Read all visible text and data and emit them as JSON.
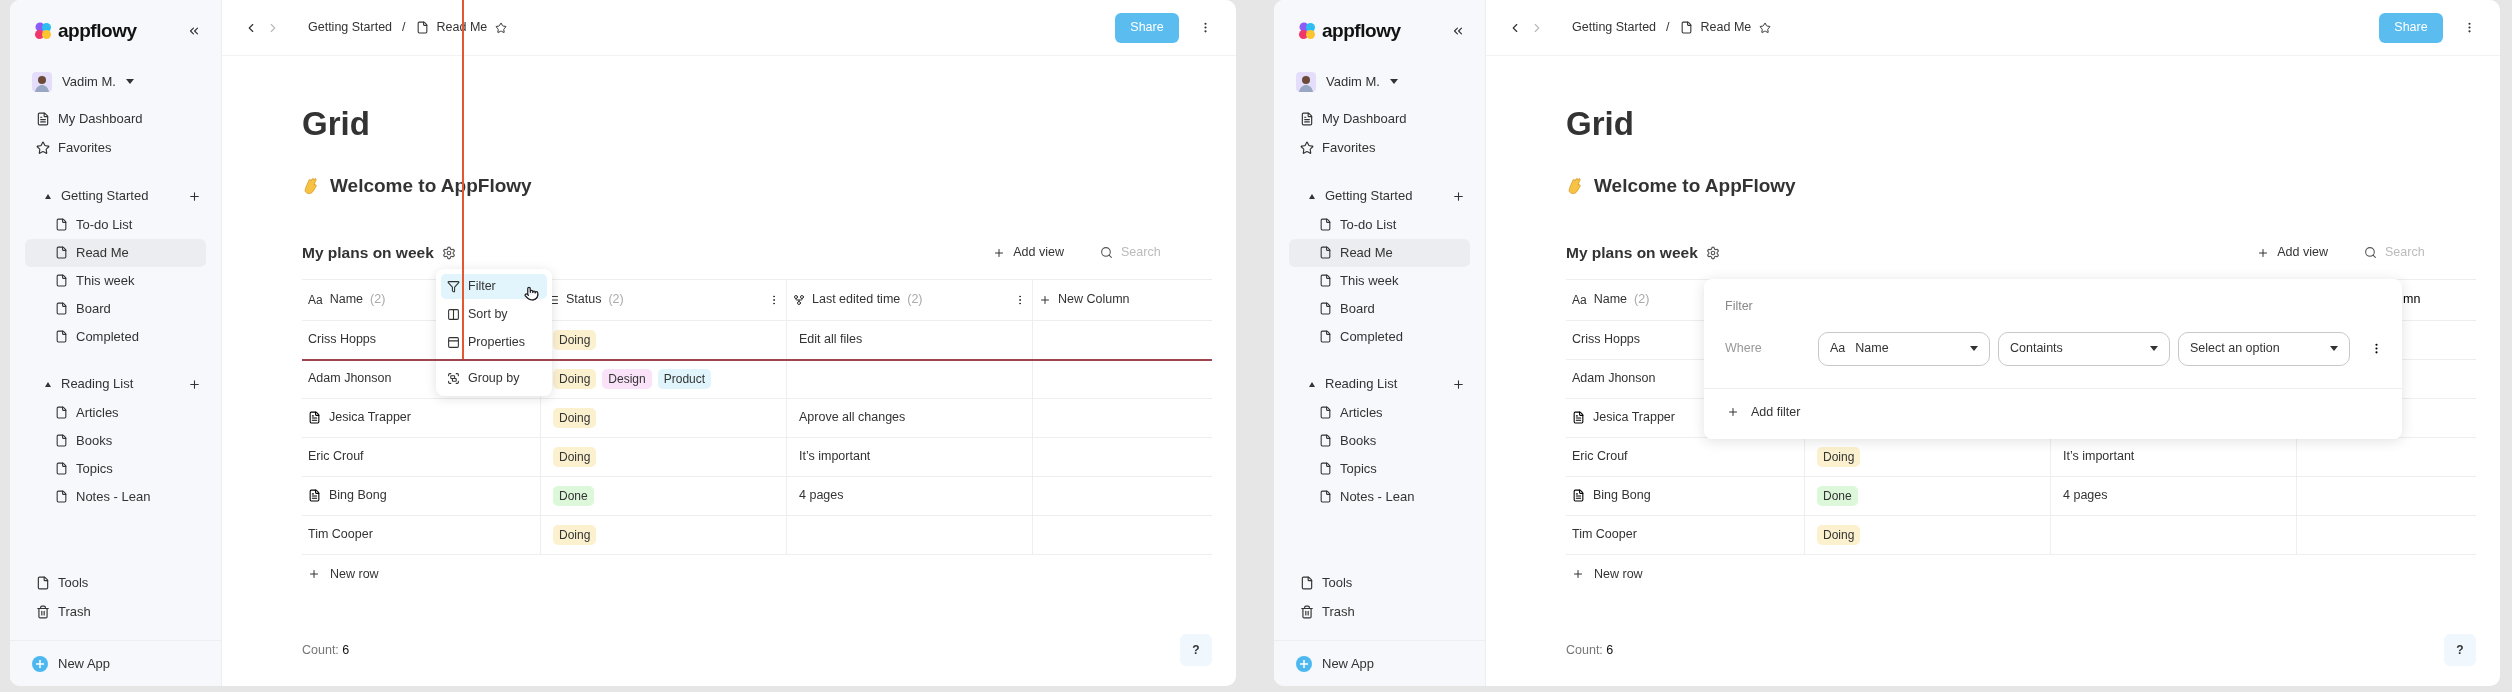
{
  "screens": [
    {
      "sidebar": {
        "logo": "appflowy",
        "user": "Vadim M.",
        "nav": [
          {
            "label": "My Dashboard",
            "kind": "dashboard"
          },
          {
            "label": "Favorites",
            "kind": "star"
          }
        ],
        "sections": [
          {
            "title": "Getting Started",
            "expanded": true,
            "items": [
              {
                "label": "To-do List",
                "selected": false
              },
              {
                "label": "Read Me",
                "selected": true
              },
              {
                "label": "This week",
                "selected": false
              },
              {
                "label": "Board",
                "selected": false
              },
              {
                "label": "Completed",
                "selected": false
              }
            ]
          },
          {
            "title": "Reading List",
            "expanded": true,
            "items": [
              {
                "label": "Articles",
                "selected": false
              },
              {
                "label": "Books",
                "selected": false
              },
              {
                "label": "Topics",
                "selected": false
              },
              {
                "label": "Notes - Lean",
                "selected": false
              }
            ]
          }
        ],
        "footer_items": [
          {
            "label": "Tools",
            "kind": "page"
          },
          {
            "label": "Trash",
            "kind": "trash"
          }
        ],
        "new_app": "New App"
      },
      "header": {
        "breadcrumb": [
          "Getting Started",
          "Read Me"
        ],
        "separator": "/",
        "share": "Share"
      },
      "page": {
        "title": "Grid",
        "heading": "Welcome to AppFlowy"
      },
      "grid": {
        "title": "My plans on week",
        "add_view": "Add view",
        "search_placeholder": "Search",
        "columns": [
          {
            "kind": "text",
            "glyph": "Aa",
            "label": "Name",
            "count": "(2)"
          },
          {
            "kind": "status",
            "label": "Status",
            "count": "(2)"
          },
          {
            "kind": "time",
            "label": "Last edited time",
            "count": "(2)"
          },
          {
            "kind": "new",
            "label": "New Column"
          }
        ],
        "rows": [
          {
            "name": "Criss Hopps",
            "doc": false,
            "tags": [
              {
                "label": "Doing",
                "color": "#fbf1cf"
              }
            ],
            "note": "Edit all files"
          },
          {
            "name": "Adam Jhonson",
            "doc": false,
            "tags": [
              {
                "label": "Doing",
                "color": "#fbf1cf"
              },
              {
                "label": "Design",
                "color": "#fae3f8"
              },
              {
                "label": "Product",
                "color": "#dff4fb"
              }
            ]
          },
          {
            "name": "Jesica Trapper",
            "doc": true,
            "tags": [
              {
                "label": "Doing",
                "color": "#fbf1cf"
              }
            ],
            "note": "Aprove all changes"
          },
          {
            "name": "Eric Crouf",
            "doc": false,
            "tags": [
              {
                "label": "Doing",
                "color": "#fbf1cf"
              }
            ],
            "note": "It’s important"
          },
          {
            "name": "Bing Bong",
            "doc": true,
            "tags": [
              {
                "label": "Done",
                "color": "#ddf7db"
              }
            ],
            "note": "4 pages"
          },
          {
            "name": "Tim Cooper",
            "doc": false,
            "tags": [
              {
                "label": "Doing",
                "color": "#fbf1cf"
              }
            ]
          }
        ],
        "new_row": "New row",
        "count_label": "Count:",
        "count": "6"
      },
      "help": "?",
      "guides": true,
      "overlay": {
        "kind": "menu",
        "items": [
          {
            "label": "Filter",
            "kind": "filter",
            "selected": true
          },
          {
            "label": "Sort by",
            "kind": "sort",
            "selected": false
          },
          {
            "label": "Properties",
            "kind": "properties",
            "selected": false
          },
          {
            "label": "Group by",
            "kind": "group",
            "selected": false
          }
        ]
      }
    },
    {
      "sidebar": {
        "logo": "appflowy",
        "user": "Vadim M.",
        "nav": [
          {
            "label": "My Dashboard",
            "kind": "dashboard"
          },
          {
            "label": "Favorites",
            "kind": "star"
          }
        ],
        "sections": [
          {
            "title": "Getting Started",
            "expanded": true,
            "items": [
              {
                "label": "To-do List",
                "selected": false
              },
              {
                "label": "Read Me",
                "selected": true
              },
              {
                "label": "This week",
                "selected": false
              },
              {
                "label": "Board",
                "selected": false
              },
              {
                "label": "Completed",
                "selected": false
              }
            ]
          },
          {
            "title": "Reading List",
            "expanded": true,
            "items": [
              {
                "label": "Articles",
                "selected": false
              },
              {
                "label": "Books",
                "selected": false
              },
              {
                "label": "Topics",
                "selected": false
              },
              {
                "label": "Notes - Lean",
                "selected": false
              }
            ]
          }
        ],
        "footer_items": [
          {
            "label": "Tools",
            "kind": "page"
          },
          {
            "label": "Trash",
            "kind": "trash"
          }
        ],
        "new_app": "New App"
      },
      "header": {
        "breadcrumb": [
          "Getting Started",
          "Read Me"
        ],
        "separator": "/",
        "share": "Share"
      },
      "page": {
        "title": "Grid",
        "heading": "Welcome to AppFlowy"
      },
      "grid": {
        "title": "My plans on week",
        "add_view": "Add view",
        "search_placeholder": "Search",
        "columns": [
          {
            "kind": "text",
            "glyph": "Aa",
            "label": "Name",
            "count": "(2)"
          },
          {
            "kind": "status"
          },
          {
            "kind": "time"
          },
          {
            "kind": "fragment",
            "label": "mn"
          }
        ],
        "rows": [
          {
            "name": "Criss Hopps",
            "doc": false
          },
          {
            "name": "Adam Jhonson",
            "doc": false
          },
          {
            "name": "Jesica Trapper",
            "doc": true
          },
          {
            "name": "Eric Crouf",
            "doc": false,
            "tags": [
              {
                "label": "Doing",
                "color": "#fbf1cf"
              }
            ],
            "note": "It’s important"
          },
          {
            "name": "Bing Bong",
            "doc": true,
            "tags": [
              {
                "label": "Done",
                "color": "#ddf7db"
              }
            ],
            "note": "4 pages"
          },
          {
            "name": "Tim Cooper",
            "doc": false,
            "tags": [
              {
                "label": "Doing",
                "color": "#fbf1cf"
              }
            ]
          }
        ],
        "new_row": "New row",
        "count_label": "Count:",
        "count": "6"
      },
      "help": "?",
      "guides": false,
      "overlay": {
        "kind": "filter",
        "title": "Filter",
        "where": "Where",
        "selects": [
          {
            "kind": "field",
            "glyph": "Aa",
            "value": "Name"
          },
          {
            "kind": "plain",
            "value": "Containts"
          },
          {
            "kind": "plain",
            "value": "Select an option"
          }
        ],
        "add": "Add filter"
      }
    }
  ]
}
